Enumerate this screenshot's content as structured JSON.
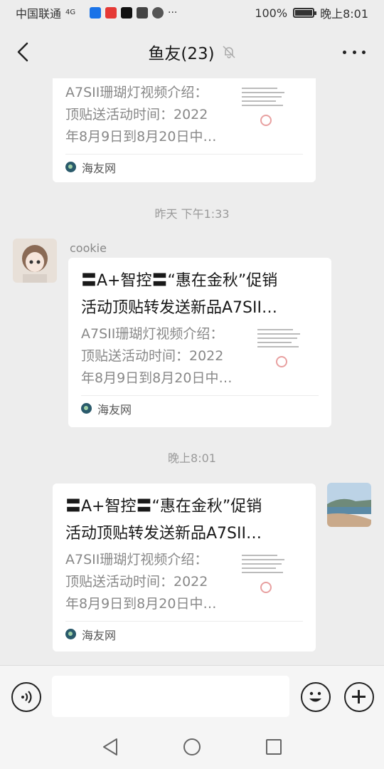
{
  "status_bar": {
    "carrier": "中国联通",
    "network": "4G",
    "battery": "100%",
    "time": "晚上8:01"
  },
  "nav": {
    "title": "鱼友(23)"
  },
  "messages": [
    {
      "title": "",
      "description": "A7SII珊瑚灯视频介绍：\n顶贴送活动时间：2022\n年8月9日到8月20日中…",
      "source": "海友网"
    },
    {
      "time": "昨天 下午1:33",
      "sender": "cookie",
      "title": "〓A+智控〓“惠在金秋”促销活动顶贴转发送新品A7SII…",
      "title_line1": "〓A+智控〓“惠在金秋”促销",
      "title_line2": "活动顶贴转发送新品A7SII…",
      "description": "A7SII珊瑚灯视频介绍：\n顶贴送活动时间：2022\n年8月9日到8月20日中…",
      "source": "海友网"
    },
    {
      "time": "晚上8:01",
      "title_line1": "〓A+智控〓“惠在金秋”促销",
      "title_line2": "活动顶贴转发送新品A7SII…",
      "description": "A7SII珊瑚灯视频介绍：\n顶贴送活动时间：2022\n年8月9日到8月20日中…",
      "source": "海友网"
    }
  ],
  "colors": {
    "background": "#ededed",
    "card": "#ffffff",
    "source_icon": "#2a5a6b"
  }
}
